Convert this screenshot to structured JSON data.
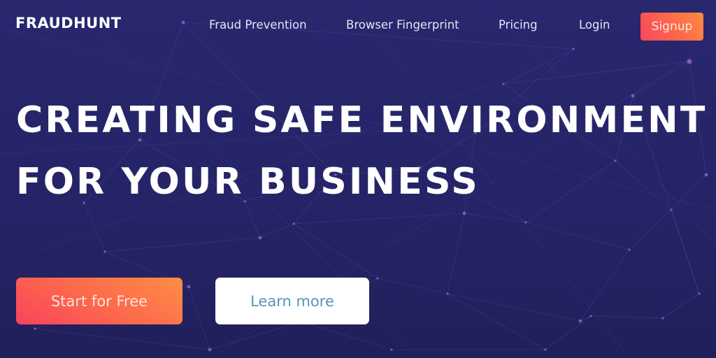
{
  "brand": {
    "name": "FRAUDHUNT"
  },
  "nav": {
    "links": [
      {
        "label": "Fraud Prevention"
      },
      {
        "label": "Browser Fingerprint"
      },
      {
        "label": "Pricing"
      },
      {
        "label": "Login"
      }
    ],
    "signup_label": "Signup"
  },
  "hero": {
    "title_line1": "CREATING SAFE ENVIRONMENT",
    "title_line2": "FOR YOUR BUSINESS",
    "primary_cta": "Start for Free",
    "secondary_cta": "Learn more"
  },
  "colors": {
    "background": "#27256b",
    "accent_start": "#f9435d",
    "accent_end": "#fe8d46",
    "secondary_text": "#5a93b5"
  }
}
